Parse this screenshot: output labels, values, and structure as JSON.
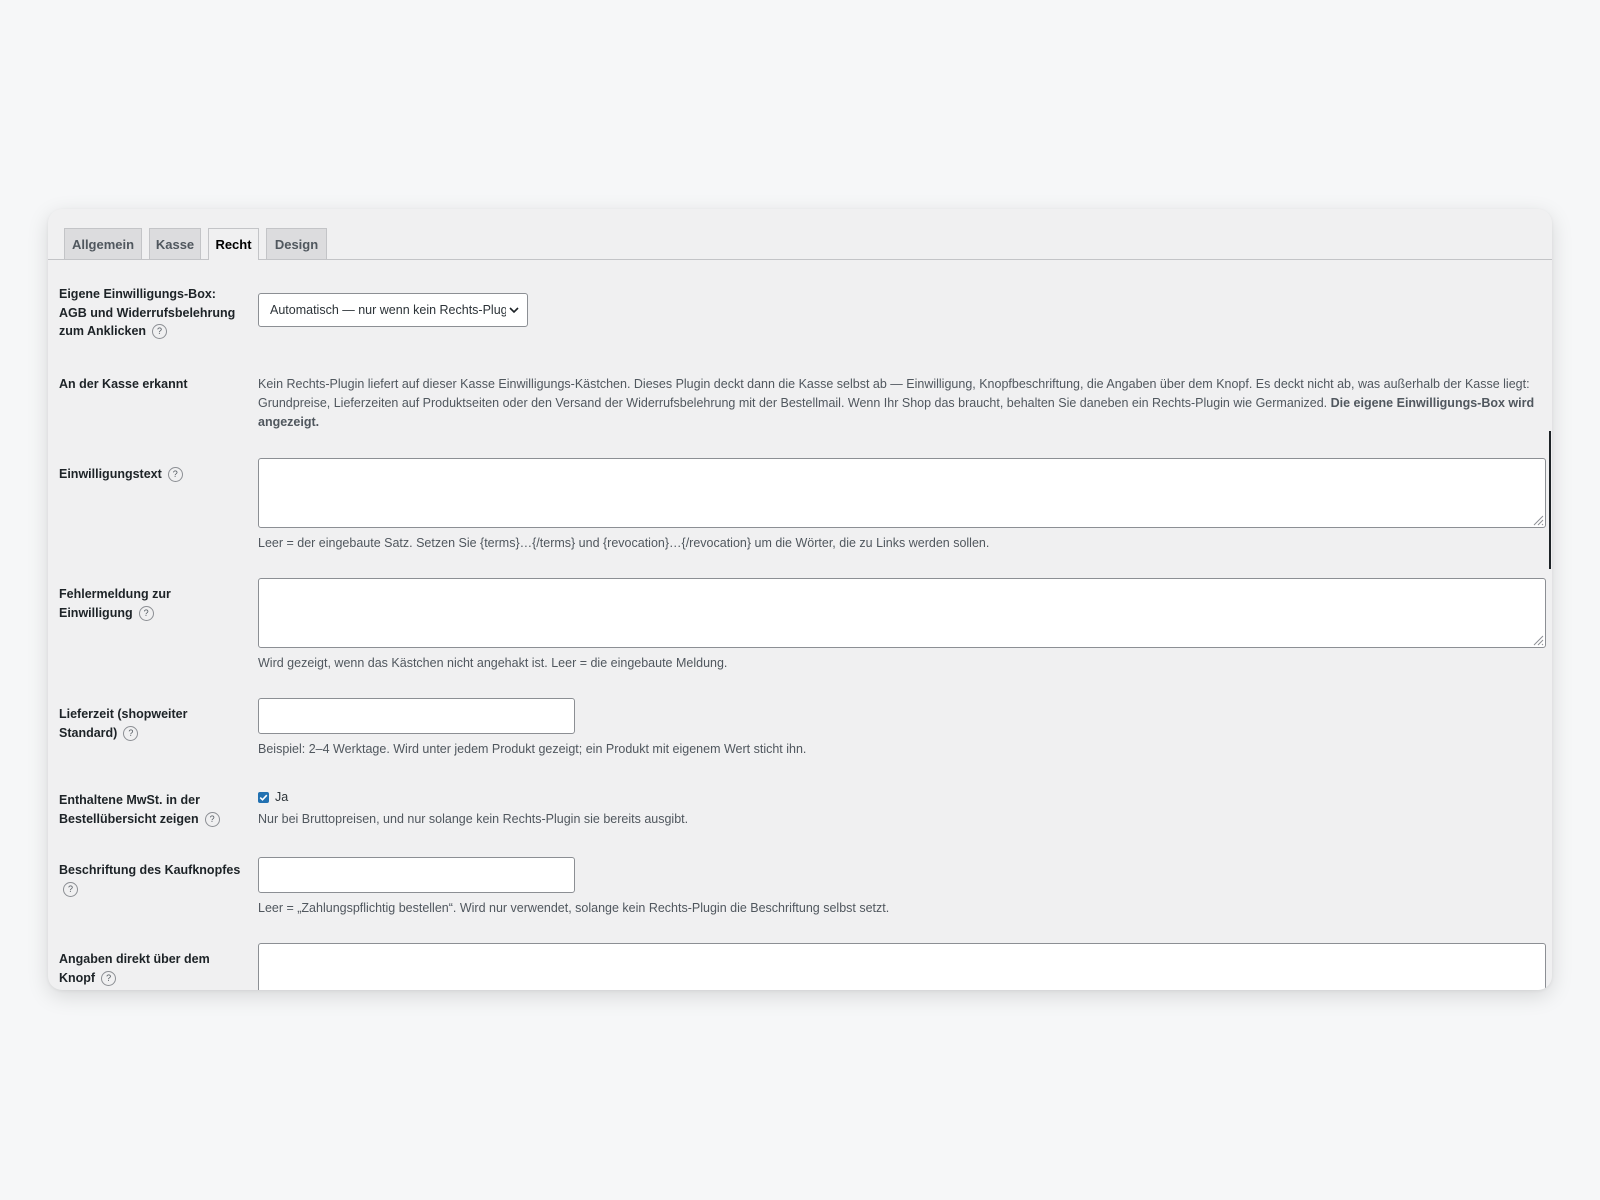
{
  "tabs": [
    {
      "label": "Allgemein",
      "active": false
    },
    {
      "label": "Kasse",
      "active": false
    },
    {
      "label": "Recht",
      "active": true
    },
    {
      "label": "Design",
      "active": false
    }
  ],
  "consent_box": {
    "label": "Eigene Einwilligungs-Box: AGB und Widerrufsbelehrung zum Anklicken",
    "selected": "Automatisch — nur wenn kein Rechts-Plugin"
  },
  "checkout_detected": {
    "label": "An der Kasse erkannt",
    "text": "Kein Rechts-Plugin liefert auf dieser Kasse Einwilligungs-Kästchen. Dieses Plugin deckt dann die Kasse selbst ab — Einwilligung, Knopfbeschriftung, die Angaben über dem Knopf. Es deckt nicht ab, was außerhalb der Kasse liegt: Grundpreise, Lieferzeiten auf Produktseiten oder den Versand der Widerrufsbelehrung mit der Bestellmail. Wenn Ihr Shop das braucht, behalten Sie daneben ein Rechts-Plugin wie Germanized. ",
    "text_bold": "Die eigene Einwilligungs-Box wird angezeigt."
  },
  "consent_text": {
    "label": "Einwilligungstext",
    "value": "",
    "hint": "Leer = der eingebaute Satz. Setzen Sie {terms}…{/terms} und {revocation}…{/revocation} um die Wörter, die zu Links werden sollen."
  },
  "consent_error": {
    "label": "Fehlermeldung zur Einwilligung",
    "value": "",
    "hint": "Wird gezeigt, wenn das Kästchen nicht angehakt ist. Leer = die eingebaute Meldung."
  },
  "delivery_time": {
    "label": "Lieferzeit (shopweiter Standard)",
    "value": "",
    "hint": "Beispiel: 2–4 Werktage. Wird unter jedem Produkt gezeigt; ein Produkt mit eigenem Wert sticht ihn."
  },
  "vat": {
    "label": "Enthaltene MwSt. in der Bestellübersicht zeigen",
    "checked": true,
    "checkbox_label": "Ja",
    "hint": "Nur bei Bruttopreisen, und nur solange kein Rechts-Plugin sie bereits ausgibt."
  },
  "button_label": {
    "label": "Beschriftung des Kaufknopfes",
    "value": "",
    "hint": "Leer = „Zahlungspflichtig bestellen“. Wird nur verwendet, solange kein Rechts-Plugin die Beschriftung selbst setzt."
  },
  "above_button": {
    "label": "Angaben direkt über dem Knopf",
    "value": ""
  },
  "icons": {
    "help": "help-icon",
    "select_arrow": "chevron-down-icon",
    "resize": "resize-handle-icon",
    "checkbox": "checkmark-icon"
  },
  "colors": {
    "checkbox": "#2271b1",
    "panel": "#f0f0f1",
    "page": "#f6f7f8"
  }
}
